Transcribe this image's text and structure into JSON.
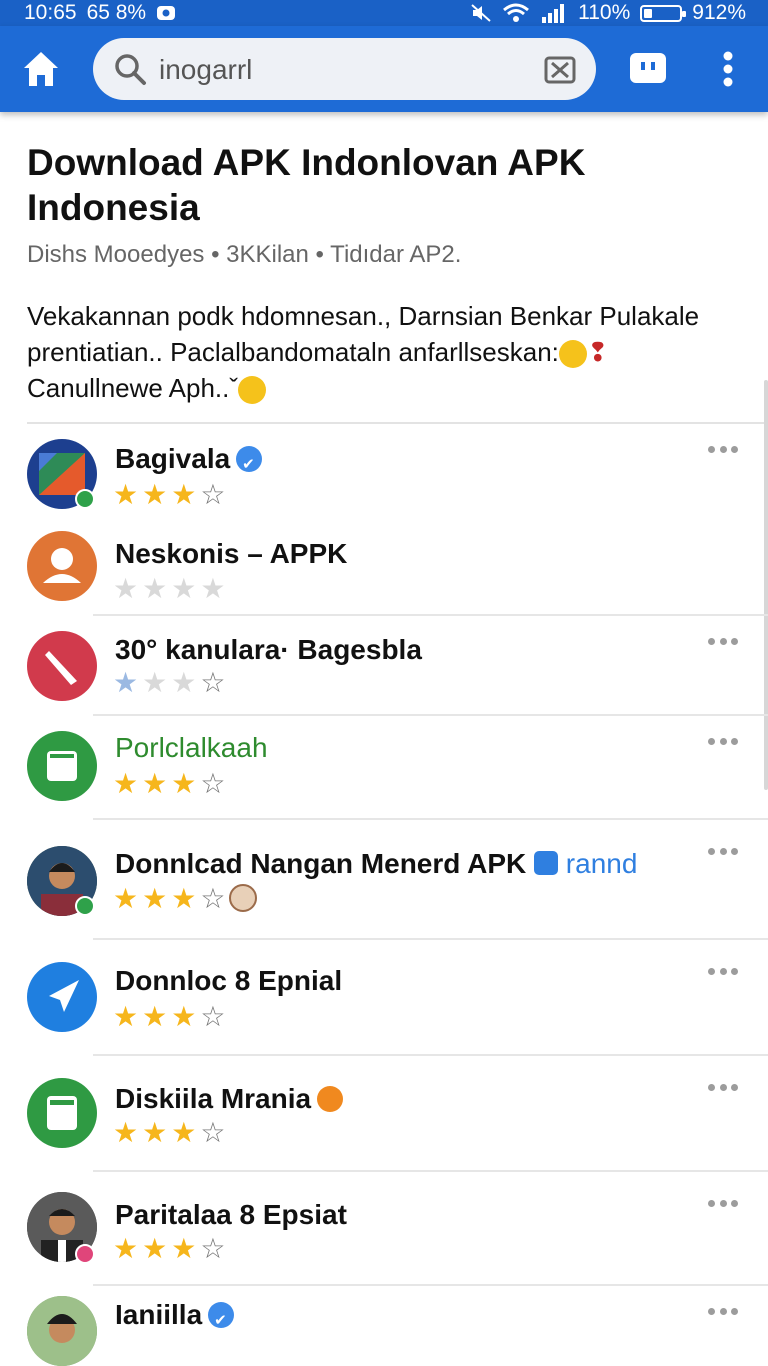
{
  "status_bar": {
    "time": "10:65",
    "extra": "65 8%",
    "battery_pct": "110%",
    "right_text": "912%"
  },
  "search": {
    "value": "inogarrl",
    "placeholder": ""
  },
  "page": {
    "title": "Download APK Indonlovan APK Indonesia",
    "subtitle": "Dishs Mooedyes • 3KKilan • Tidıdar AP2.",
    "desc_line1": "Vekakannan podk hdomnesan., Darnsian Benkar Pulakale",
    "desc_line2": "prentiatian.. Paclalbandomataln anfarllseskan:",
    "desc_line3": "Canullnewe Aph.."
  },
  "apps": [
    {
      "name": "Bagivala",
      "verified": true,
      "rating": 3,
      "more": true
    },
    {
      "name": "Neskonis – APPK",
      "verified": false,
      "rating": 0,
      "more": false
    },
    {
      "name": "30° kanulara· Bagesbla",
      "verified": false,
      "rating": 1,
      "more": true
    },
    {
      "name": "Porlclalkaah",
      "verified": false,
      "rating": 3,
      "more": true,
      "name_color": "#2e8b2e"
    },
    {
      "name": "Donnlcad Nangan Menerd APK",
      "tag": "rannd",
      "verified": false,
      "rating": 3,
      "more": true
    },
    {
      "name": "Donnloc 8 Epnial",
      "verified": false,
      "rating": 3,
      "more": true
    },
    {
      "name": "Diskiila Mrania",
      "verified": false,
      "rating": 3,
      "more": true
    },
    {
      "name": "Paritalaa 8 Epsiat",
      "verified": false,
      "rating": 3,
      "more": true
    },
    {
      "name": "Ianiilla",
      "verified": true,
      "rating": 3,
      "more": true
    }
  ],
  "colors": {
    "appbar": "#1e6bd6",
    "star": "#f6b61c",
    "verify": "#3d8bea"
  }
}
